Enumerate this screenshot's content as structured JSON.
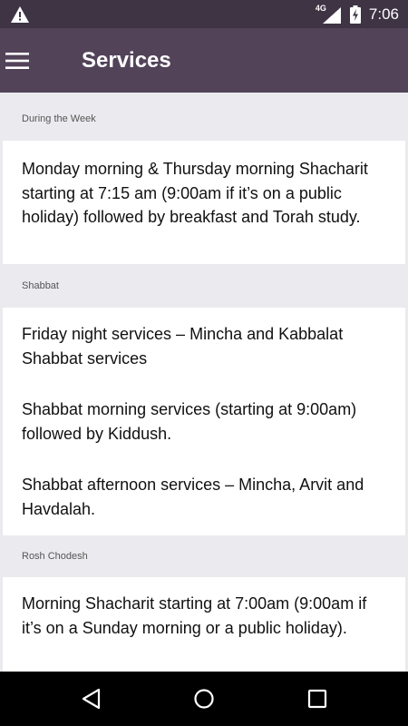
{
  "status_bar": {
    "time": "7:06",
    "network": "4G",
    "icons": [
      "warning-icon",
      "signal-icon",
      "battery-charging-icon"
    ]
  },
  "app_bar": {
    "title": "Services",
    "menu_icon": "menu-icon",
    "background": "#524359"
  },
  "sections": [
    {
      "header": "During the Week",
      "items": [
        "Monday morning & Thursday morning Shacharit starting at 7:15 am (9:00am if it’s on a public holiday) followed by breakfast and Torah study."
      ]
    },
    {
      "header": "Shabbat",
      "items": [
        "Friday night services – Mincha and Kabbalat Shabbat services",
        "Shabbat morning services (starting at 9:00am) followed by Kiddush.",
        "Shabbat afternoon services – Mincha, Arvit and Havdalah."
      ]
    },
    {
      "header": "Rosh Chodesh",
      "items": [
        "Morning Shacharit starting at 7:00am (9:00am if it’s on a Sunday morning or a public holiday)."
      ]
    }
  ],
  "nav_bar": {
    "icons": [
      "back-icon",
      "home-icon",
      "recents-icon"
    ]
  }
}
